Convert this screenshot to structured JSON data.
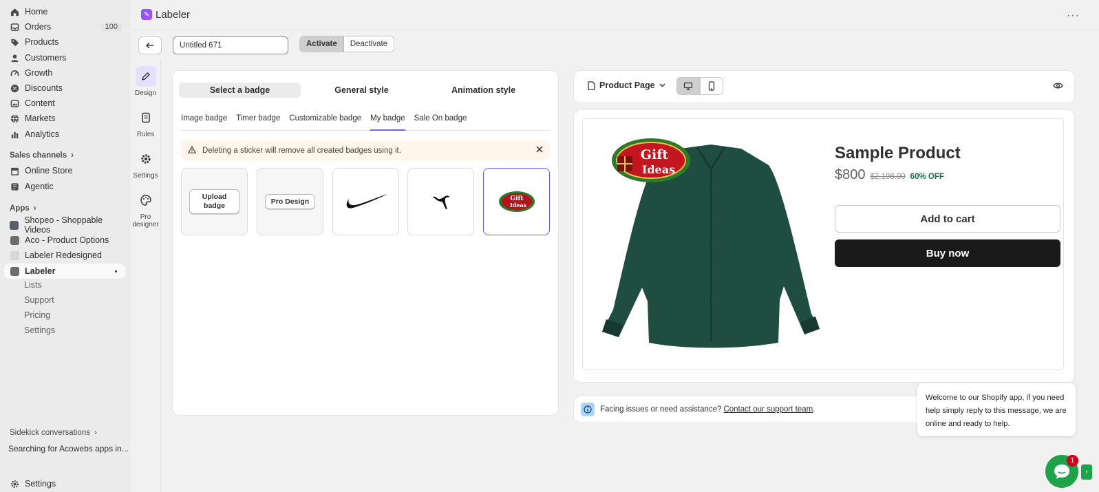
{
  "sidebar": {
    "items": [
      {
        "label": "Home",
        "icon": "home-icon"
      },
      {
        "label": "Orders",
        "icon": "inbox-icon",
        "badge": "100"
      },
      {
        "label": "Products",
        "icon": "tag-icon"
      },
      {
        "label": "Customers",
        "icon": "person-icon"
      },
      {
        "label": "Growth",
        "icon": "gauge-icon"
      },
      {
        "label": "Discounts",
        "icon": "discount-icon"
      },
      {
        "label": "Content",
        "icon": "content-icon"
      },
      {
        "label": "Markets",
        "icon": "globe-icon"
      },
      {
        "label": "Analytics",
        "icon": "chart-icon"
      }
    ],
    "sales_channels_title": "Sales channels",
    "channels": [
      {
        "label": "Online Store",
        "icon": "store-icon"
      },
      {
        "label": "Agentic",
        "icon": "agentic-icon"
      }
    ],
    "apps_title": "Apps",
    "apps": [
      {
        "label": "Shopeo - Shoppable Videos"
      },
      {
        "label": "Aco - Product Options"
      },
      {
        "label": "Labeler Redesigned"
      },
      {
        "label": "Labeler"
      }
    ],
    "labeler_sub": [
      "Lists",
      "Support",
      "Pricing",
      "Settings"
    ],
    "sidekick_title": "Sidekick conversations",
    "sidekick_item": "Searching for Acowebs apps in...",
    "settings_label": "Settings"
  },
  "header": {
    "title": "Labeler"
  },
  "toolbar": {
    "name_value": "Untitled 671",
    "activate_label": "Activate",
    "deactivate_label": "Deactivate"
  },
  "rail": {
    "items": [
      {
        "label": "Design"
      },
      {
        "label": "Rules"
      },
      {
        "label": "Settings"
      },
      {
        "label": "Pro designer"
      }
    ]
  },
  "editor": {
    "tabs": [
      "Select a badge",
      "General style",
      "Animation style"
    ],
    "subtabs": [
      "Image badge",
      "Timer badge",
      "Customizable badge",
      "My badge",
      "Sale On badge"
    ],
    "banner": "Deleting a sticker will remove all created badges using it.",
    "upload_label": "Upload badge",
    "pro_label": "Pro Design",
    "badge_text_line1": "Gift",
    "badge_text_line2": "Ideas"
  },
  "preview": {
    "page_select": "Product Page",
    "product_title": "Sample Product",
    "price": "$800",
    "compare_price": "$2,198.00",
    "discount": "60% OFF",
    "add_to_cart": "Add to cart",
    "buy_now": "Buy now"
  },
  "help": {
    "text": "Facing issues or need assistance?",
    "link": "Contact our support team",
    "suffix": "."
  },
  "chat": {
    "message": "Welcome to our Shopify app, if you need help simply reply to this message, we are online and ready to help.",
    "count": "1"
  },
  "colors": {
    "accent": "#7a5cff",
    "buy_button": "#1a1a1a",
    "chat_green": "#1fa34a",
    "discount_green": "#1b6b4a"
  }
}
